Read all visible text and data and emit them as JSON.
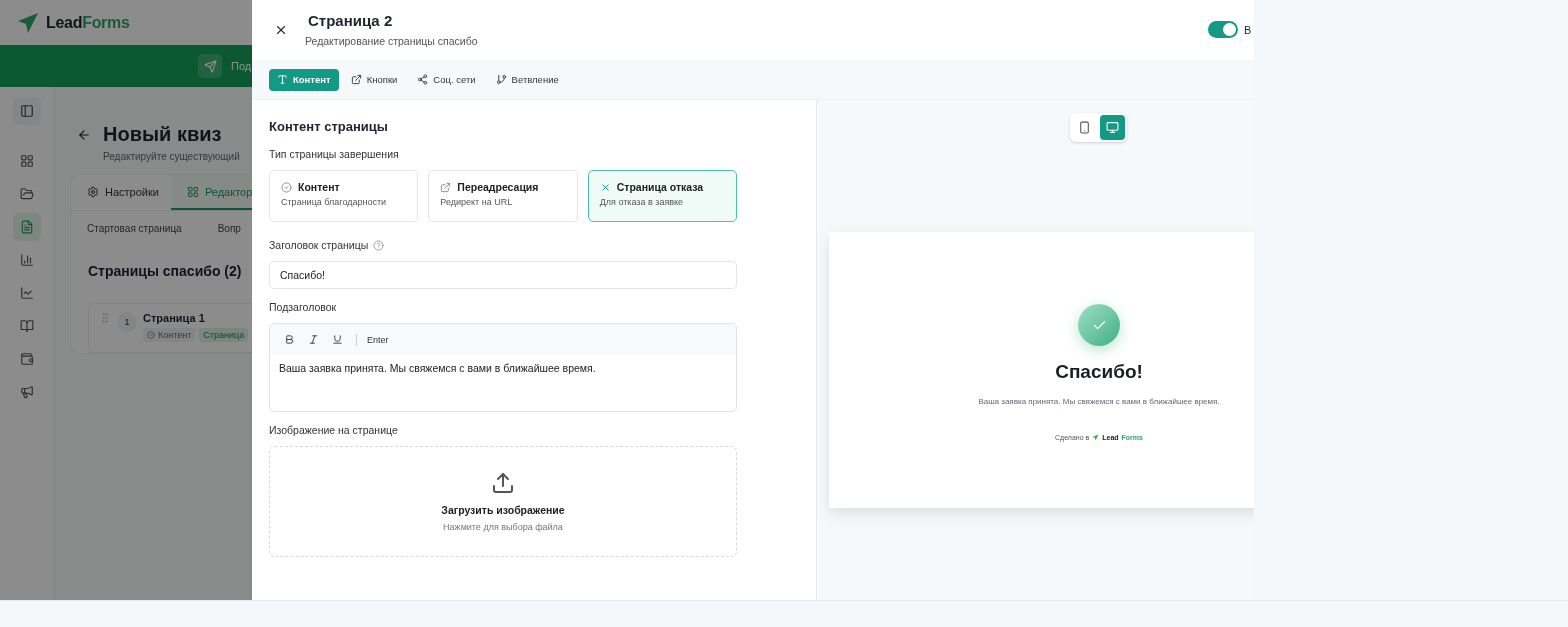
{
  "background_app": {
    "logo": {
      "lead": "Lead",
      "forms": "Forms"
    },
    "banner_text": "Под",
    "sidebar": [
      {
        "kind": "grid",
        "selected": false
      },
      {
        "kind": "folder",
        "selected": false
      },
      {
        "kind": "file",
        "selected": true
      },
      {
        "kind": "bars",
        "selected": false
      },
      {
        "kind": "line",
        "selected": false
      },
      {
        "kind": "book",
        "selected": false
      },
      {
        "kind": "wallet",
        "selected": false
      },
      {
        "kind": "megaphone",
        "selected": false
      }
    ],
    "title": "Новый квиз",
    "subtitle": "Редактируйте существующий",
    "tabs": [
      {
        "label": "Настройки",
        "kind": "settings",
        "selected": false
      },
      {
        "label": "Редактор",
        "kind": "grid",
        "selected": true
      }
    ],
    "steps": [
      "Стартовая страница",
      "Вопр"
    ],
    "section_title": "Страницы спасибо (2)",
    "page_card": {
      "number": "1",
      "title": "Страница 1",
      "tags": [
        {
          "label": "Контент",
          "kind": "type"
        },
        {
          "label": "Страница",
          "kind": "status"
        }
      ]
    }
  },
  "drawer": {
    "title": "Страница 2",
    "subtitle": "Редактирование страницы спасибо",
    "toggle": {
      "on": true,
      "label": "В"
    },
    "tabs": [
      {
        "label": "Контент",
        "kind": "text",
        "selected": true
      },
      {
        "label": "Кнопки",
        "kind": "external",
        "selected": false
      },
      {
        "label": "Соц. сети",
        "kind": "share",
        "selected": false
      },
      {
        "label": "Ветвление",
        "kind": "branch",
        "selected": false
      }
    ],
    "section_title": "Контент страницы",
    "type_label": "Тип страницы завершения",
    "types": [
      {
        "title": "Контент",
        "description": "Страница благодарности",
        "kind": "check",
        "selected": false
      },
      {
        "title": "Переадресация",
        "description": "Редирект на URL",
        "kind": "external",
        "selected": false
      },
      {
        "title": "Страница отказа",
        "description": "Для отказа в заявке",
        "kind": "cross",
        "selected": true
      }
    ],
    "title_field": {
      "label": "Заголовок страницы",
      "value": "Спасибо!"
    },
    "subtitle_field": {
      "label": "Подзаголовок",
      "tools": [
        {
          "kind": "bold"
        },
        {
          "kind": "italic"
        },
        {
          "kind": "underline"
        }
      ],
      "action": "Enter",
      "value": "Ваша заявка принята. Мы свяжемся с вами в ближайшее время."
    },
    "image": {
      "label": "Изображение на странице",
      "upload_title": "Загрузить изображение",
      "upload_hint": "Нажмите для выбора файла"
    },
    "preview": {
      "devices": [
        {
          "kind": "mobile",
          "selected": false
        },
        {
          "kind": "desktop",
          "selected": true
        }
      ],
      "title": "Спасибо!",
      "text": "Ваша заявка принята. Мы свяжемся с вами в ближайшее время.",
      "footer": {
        "prefix": "Сделано в",
        "lead": "Lead",
        "forms": "Forms"
      }
    }
  }
}
